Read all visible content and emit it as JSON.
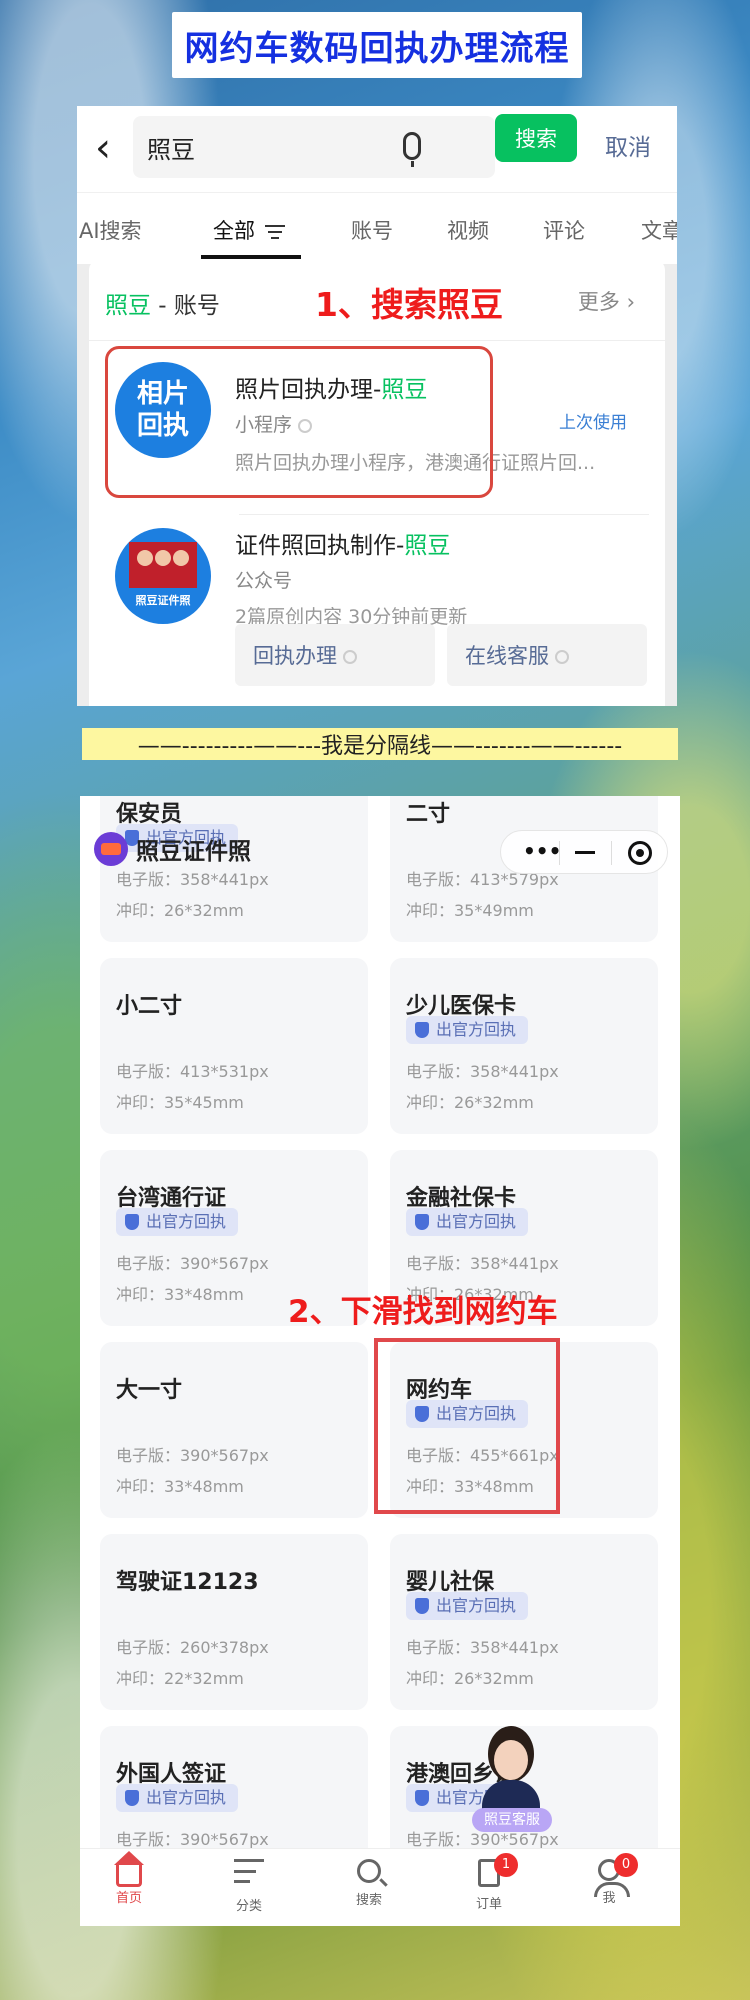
{
  "banner": {
    "title": "网约车数码回执办理流程"
  },
  "search": {
    "query": "照豆",
    "search_button": "搜索",
    "cancel": "取消",
    "tabs": [
      "AI搜索",
      "全部",
      "账号",
      "视频",
      "评论",
      "文章"
    ],
    "section_title_green": "照豆",
    "section_title_rest": " - 账号",
    "more": "更多",
    "step1": "1、搜索照豆",
    "item1": {
      "logo_line1": "相片",
      "logo_line2": "回执",
      "title_prefix": "照片回执办理-",
      "title_green": "照豆",
      "type": "小程序",
      "last_used": "上次使用",
      "desc": "照片回执办理小程序，港澳通行证照片回..."
    },
    "item2": {
      "logo_label": "照豆证件照",
      "title_prefix": "证件照回执制作-",
      "title_green": "照豆",
      "type": "公众号",
      "meta": "2篇原创内容  30分钟前更新",
      "btn1": "回执办理",
      "btn2": "在线客服"
    }
  },
  "divider": {
    "text": "——---------——---我是分隔线——-------——------"
  },
  "miniprogram": {
    "brand": "照豆证件照",
    "step2": "2、下滑找到网约车",
    "assistant_label": "照豆客服",
    "cards": [
      {
        "name": "保安员",
        "badge": "出官方回执",
        "e": "电子版：358*441px",
        "p": "冲印：26*32mm"
      },
      {
        "name": "二寸",
        "badge": "",
        "e": "电子版：413*579px",
        "p": "冲印：35*49mm"
      },
      {
        "name": "小二寸",
        "badge": "",
        "e": "电子版：413*531px",
        "p": "冲印：35*45mm"
      },
      {
        "name": "少儿医保卡",
        "badge": "出官方回执",
        "e": "电子版：358*441px",
        "p": "冲印：26*32mm"
      },
      {
        "name": "台湾通行证",
        "badge": "出官方回执",
        "e": "电子版：390*567px",
        "p": "冲印：33*48mm"
      },
      {
        "name": "金融社保卡",
        "badge": "出官方回执",
        "e": "电子版：358*441px",
        "p": "冲印：26*32mm"
      },
      {
        "name": "大一寸",
        "badge": "",
        "e": "电子版：390*567px",
        "p": "冲印：33*48mm"
      },
      {
        "name": "网约车",
        "badge": "出官方回执",
        "e": "电子版：455*661px",
        "p": "冲印：33*48mm"
      },
      {
        "name": "驾驶证12123",
        "badge": "",
        "e": "电子版：260*378px",
        "p": "冲印：22*32mm"
      },
      {
        "name": "婴儿社保",
        "badge": "出官方回执",
        "e": "电子版：358*441px",
        "p": "冲印：26*32mm"
      },
      {
        "name": "外国人签证",
        "badge": "出官方回执",
        "e": "电子版：390*567px",
        "p": ""
      },
      {
        "name": "港澳回乡证",
        "badge": "出官方回执",
        "e": "电子版：390*567px",
        "p": ""
      }
    ],
    "tabbar": [
      {
        "label": "首页",
        "badge": ""
      },
      {
        "label": "分类",
        "badge": ""
      },
      {
        "label": "搜索",
        "badge": ""
      },
      {
        "label": "订单",
        "badge": "1"
      },
      {
        "label": "我",
        "badge": "0"
      }
    ]
  },
  "colors": {
    "brand_green": "#07c160",
    "annotation_red": "#ee1c1c",
    "title_blue": "#1530e0"
  }
}
